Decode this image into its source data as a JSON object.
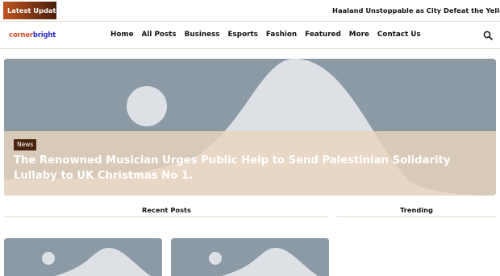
{
  "ticker": {
    "label": "Latest Update",
    "headline": "Haaland Unstoppable as City Defeat the Yellow Subr"
  },
  "header": {
    "logo_part1": "corner",
    "logo_part2": "bright",
    "nav": [
      "Home",
      "All Posts",
      "Business",
      "Esports",
      "Fashion",
      "Featured",
      "More",
      "Contact Us"
    ],
    "search_icon": "search-icon"
  },
  "hero": {
    "category": "News",
    "title": "The Renowned Musician Urges Public Help to Send Palestinian Solidarity Lullaby to UK Christmas No 1."
  },
  "sections": {
    "recent": "Recent Posts",
    "trending": "Trending"
  },
  "colors": {
    "accent": "#d2502a",
    "logo_blue": "#2a2ad2",
    "placeholder_bg": "#8c9aa6",
    "placeholder_shape": "#dde1e6",
    "overlay": "#e9d4bc"
  }
}
